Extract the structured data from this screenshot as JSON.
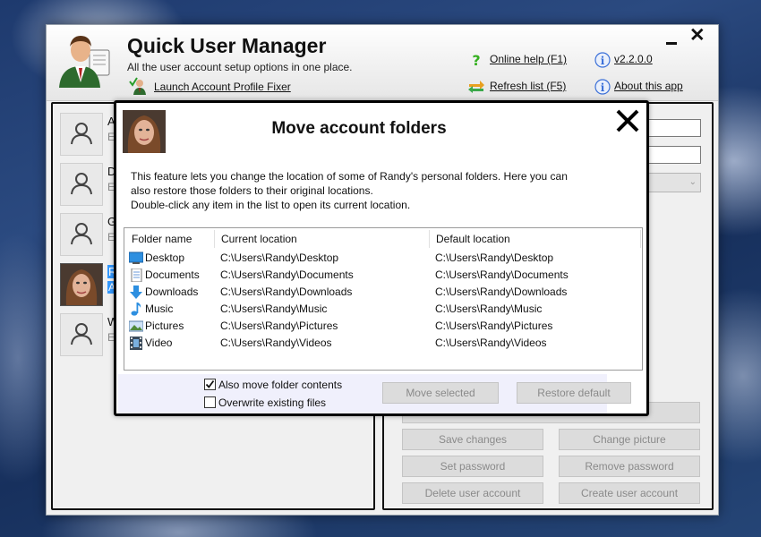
{
  "app": {
    "title": "Quick User Manager",
    "subtitle": "All the user account setup options in one place.",
    "launch_fixer": "Launch Account Profile Fixer",
    "online_help": "Online help (F1)",
    "refresh_list": "Refresh list (F5)",
    "version": "v2.2.0.0",
    "about": "About this app"
  },
  "users": [
    {
      "letter": "A",
      "sub": "E",
      "avatar": "person-icon",
      "selected": false
    },
    {
      "letter": "D",
      "sub": "E",
      "avatar": "person-icon",
      "selected": false
    },
    {
      "letter": "G",
      "sub": "E",
      "avatar": "person-icon",
      "selected": false
    },
    {
      "letter": "R",
      "sub": "A",
      "avatar": "user-photo",
      "selected": true
    },
    {
      "letter": "W",
      "sub": "E",
      "avatar": "person-icon",
      "selected": false
    }
  ],
  "actions": {
    "save_changes": "Save changes",
    "change_picture": "Change picture",
    "set_password": "Set password",
    "remove_password": "Remove password",
    "delete_user": "Delete user account",
    "create_user": "Create user account"
  },
  "dialog": {
    "title": "Move account folders",
    "desc_line1": "This feature lets you change the location of some of Randy's personal folders. Here you can",
    "desc_line2": "also restore those folders to their original locations.",
    "desc_line3": "Double-click any item in the list to open its current location.",
    "columns": {
      "name": "Folder name",
      "current": "Current location",
      "default": "Default location"
    },
    "folders": [
      {
        "name": "Desktop",
        "current": "C:\\Users\\Randy\\Desktop",
        "default": "C:\\Users\\Randy\\Desktop",
        "icon": "desktop-icon"
      },
      {
        "name": "Documents",
        "current": "C:\\Users\\Randy\\Documents",
        "default": "C:\\Users\\Randy\\Documents",
        "icon": "documents-icon"
      },
      {
        "name": "Downloads",
        "current": "C:\\Users\\Randy\\Downloads",
        "default": "C:\\Users\\Randy\\Downloads",
        "icon": "downloads-icon"
      },
      {
        "name": "Music",
        "current": "C:\\Users\\Randy\\Music",
        "default": "C:\\Users\\Randy\\Music",
        "icon": "music-icon"
      },
      {
        "name": "Pictures",
        "current": "C:\\Users\\Randy\\Pictures",
        "default": "C:\\Users\\Randy\\Pictures",
        "icon": "pictures-icon"
      },
      {
        "name": "Video",
        "current": "C:\\Users\\Randy\\Videos",
        "default": "C:\\Users\\Randy\\Videos",
        "icon": "video-icon"
      }
    ],
    "also_move_label": "Also move folder contents",
    "also_move_checked": true,
    "overwrite_label": "Overwrite existing files",
    "overwrite_checked": false,
    "move_selected": "Move selected",
    "restore_default": "Restore default"
  },
  "colors": {
    "selection": "#3399ff",
    "disabled_text": "#8a8a8a",
    "help_icon": "#35b020",
    "info_icon": "#3a6fd8"
  }
}
